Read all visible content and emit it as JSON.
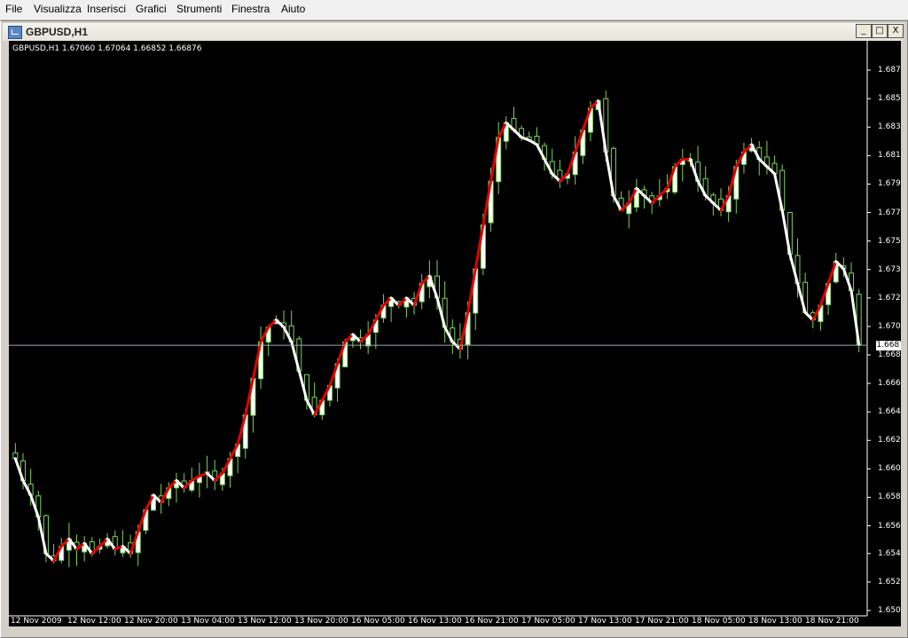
{
  "menu": [
    "File",
    "Visualizza",
    "Inserisci",
    "Grafici",
    "Strumenti",
    "Finestra",
    "Aiuto"
  ],
  "window": {
    "title": "GBPUSD,H1",
    "buttons": [
      "_",
      "□",
      "X"
    ]
  },
  "chart_info": "GBPUSD,H1  1.67060 1.67064 1.66852 1.66876",
  "current_price": "1.66876",
  "price_labels": [
    "1.68760",
    "1.68565",
    "1.68370",
    "1.68175",
    "1.67980",
    "1.67785",
    "1.67590",
    "1.67395",
    "1.67200",
    "1.67005",
    "1.66810",
    "1.66615",
    "1.66420",
    "1.66225",
    "1.66030",
    "1.65835",
    "1.65640",
    "1.65450",
    "1.65255",
    "1.65060"
  ],
  "time_labels": [
    "12 Nov 2009",
    "12 Nov 12:00",
    "12 Nov 20:00",
    "13 Nov 04:00",
    "13 Nov 12:00",
    "13 Nov 20:00",
    "16 Nov 05:00",
    "16 Nov 13:00",
    "16 Nov 21:00",
    "17 Nov 05:00",
    "17 Nov 13:00",
    "17 Nov 21:00",
    "18 Nov 05:00",
    "18 Nov 13:00",
    "18 Nov 21:00"
  ],
  "colors": {
    "bull": "#ffffff",
    "bear": "#000000",
    "wick": "#7cd35a",
    "ma_up": "#e00000",
    "ma_down": "#ffffff"
  },
  "chart_data": {
    "type": "candlestick",
    "symbol": "GBPUSD",
    "timeframe": "H1",
    "ylim": [
      1.6506,
      1.689
    ],
    "close_series": [
      1.661,
      1.6595,
      1.6585,
      1.657,
      1.6545,
      1.654,
      1.655,
      1.6555,
      1.6548,
      1.6552,
      1.6545,
      1.655,
      1.6555,
      1.6548,
      1.655,
      1.6545,
      1.656,
      1.6575,
      1.6585,
      1.658,
      1.659,
      1.6595,
      1.659,
      1.6595,
      1.6598,
      1.66,
      1.6595,
      1.66,
      1.661,
      1.662,
      1.664,
      1.6665,
      1.669,
      1.67,
      1.6705,
      1.67,
      1.669,
      1.667,
      1.665,
      1.664,
      1.665,
      1.666,
      1.6675,
      1.669,
      1.6695,
      1.669,
      1.6695,
      1.6705,
      1.6715,
      1.672,
      1.6715,
      1.672,
      1.6715,
      1.673,
      1.6735,
      1.672,
      1.67,
      1.669,
      1.6685,
      1.671,
      1.674,
      1.677,
      1.68,
      1.683,
      1.684,
      1.6835,
      1.683,
      1.6828,
      1.6825,
      1.6815,
      1.6805,
      1.68,
      1.6805,
      1.682,
      1.6835,
      1.685,
      1.6855,
      1.682,
      1.679,
      1.678,
      1.6785,
      1.6795,
      1.679,
      1.6785,
      1.679,
      1.6795,
      1.681,
      1.6815,
      1.6815,
      1.68,
      1.679,
      1.6785,
      1.678,
      1.679,
      1.681,
      1.682,
      1.6825,
      1.6815,
      1.681,
      1.6805,
      1.678,
      1.675,
      1.673,
      1.671,
      1.6705,
      1.6715,
      1.673,
      1.6745,
      1.674,
      1.6725,
      1.6688
    ]
  }
}
